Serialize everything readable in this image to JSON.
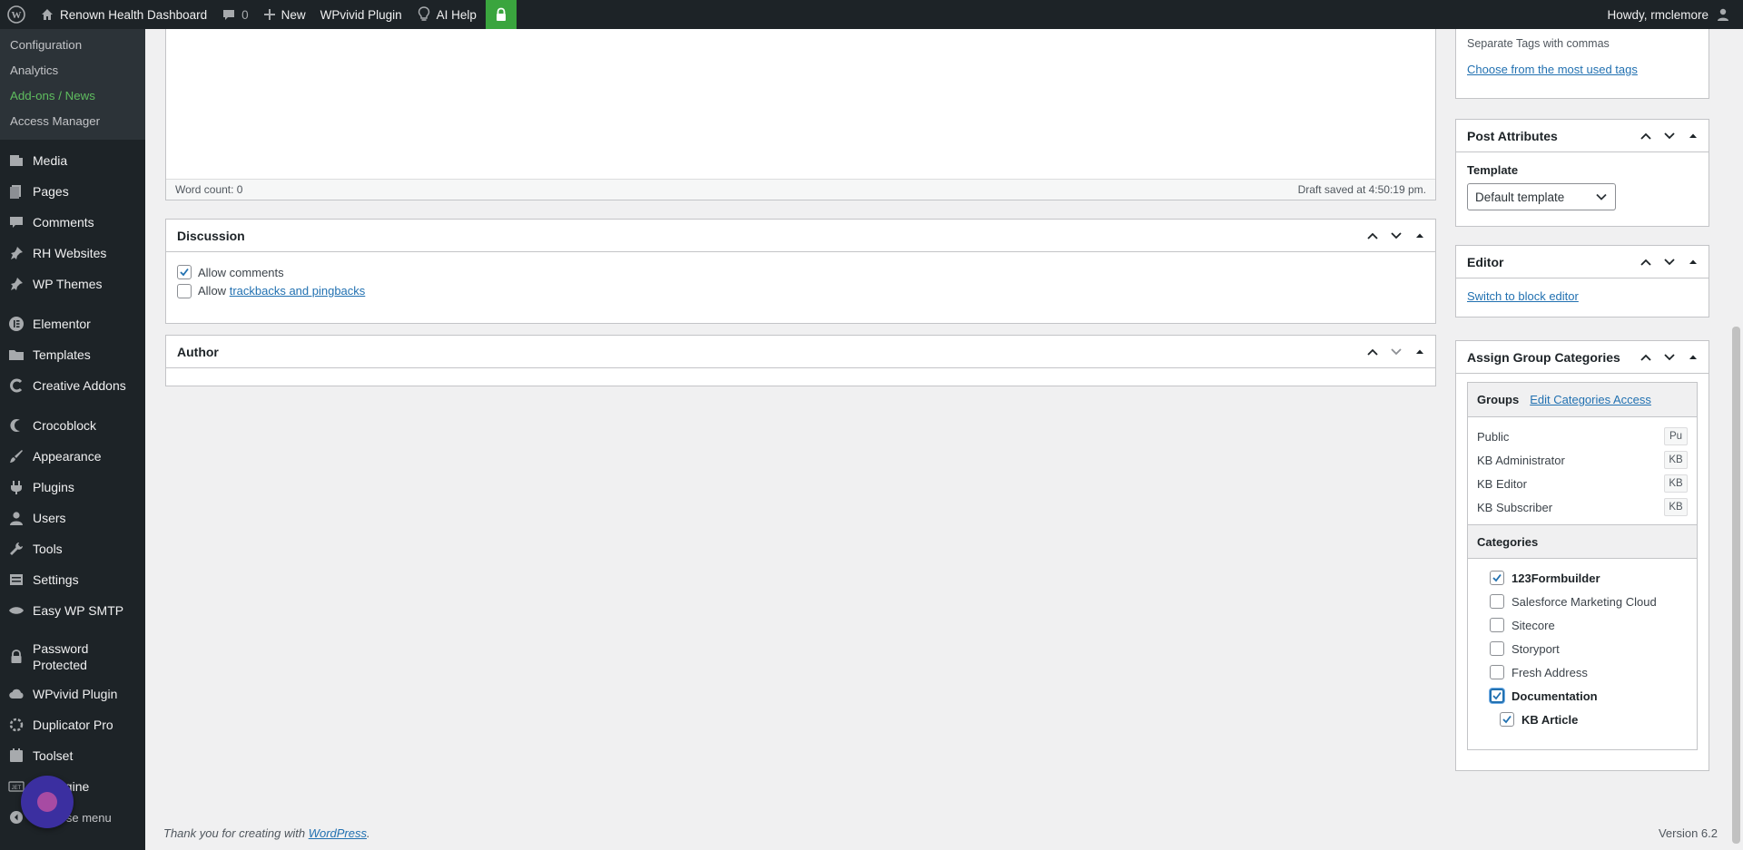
{
  "adminbar": {
    "site": "Renown Health Dashboard",
    "comments": "0",
    "new": "New",
    "wpvivid": "WPvivid Plugin",
    "ai_help": "AI Help",
    "howdy": "Howdy, rmclemore"
  },
  "sidebar": {
    "sub_items": [
      "Configuration",
      "Analytics",
      "Add-ons / News",
      "Access Manager"
    ],
    "items": [
      "Media",
      "Pages",
      "Comments",
      "RH Websites",
      "WP Themes",
      "Elementor",
      "Templates",
      "Creative Addons",
      "Crocoblock",
      "Appearance",
      "Plugins",
      "Users",
      "Tools",
      "Settings",
      "Easy WP SMTP",
      "Password Protected",
      "WPvivid Plugin",
      "Duplicator Pro",
      "Toolset",
      "JetEngine",
      "Collapse menu"
    ]
  },
  "editor": {
    "word_count": "Word count: 0",
    "draft_saved": "Draft saved at 4:50:19 pm."
  },
  "discussion": {
    "title": "Discussion",
    "allow_comments": "Allow comments",
    "allow_prefix": "Allow",
    "trackbacks_link": "trackbacks and pingbacks"
  },
  "author": {
    "title": "Author"
  },
  "tags": {
    "hint": "Separate Tags with commas",
    "most_used": "Choose from the most used tags"
  },
  "post_attributes": {
    "title": "Post Attributes",
    "template_label": "Template",
    "template_value": "Default template"
  },
  "editor_box": {
    "title": "Editor",
    "switch_link": "Switch to block editor"
  },
  "group_categories": {
    "title": "Assign Group Categories",
    "groups_label": "Groups",
    "edit_access": "Edit Categories Access",
    "groups": [
      {
        "name": "Public",
        "tag": "Pu"
      },
      {
        "name": "KB Administrator",
        "tag": "KB"
      },
      {
        "name": "KB Editor",
        "tag": "KB"
      },
      {
        "name": "KB Subscriber",
        "tag": "KB"
      }
    ],
    "categories_label": "Categories",
    "categories": [
      {
        "name": "123Formbuilder",
        "checked": true
      },
      {
        "name": "Salesforce Marketing Cloud",
        "checked": false
      },
      {
        "name": "Sitecore",
        "checked": false
      },
      {
        "name": "Storyport",
        "checked": false
      },
      {
        "name": "Fresh Address",
        "checked": false
      },
      {
        "name": "Documentation",
        "checked": true
      },
      {
        "name": "KB Article",
        "checked": true
      }
    ]
  },
  "footer": {
    "thanks": "Thank you for creating with",
    "wp_link": "WordPress",
    "version": "Version 6.2"
  }
}
